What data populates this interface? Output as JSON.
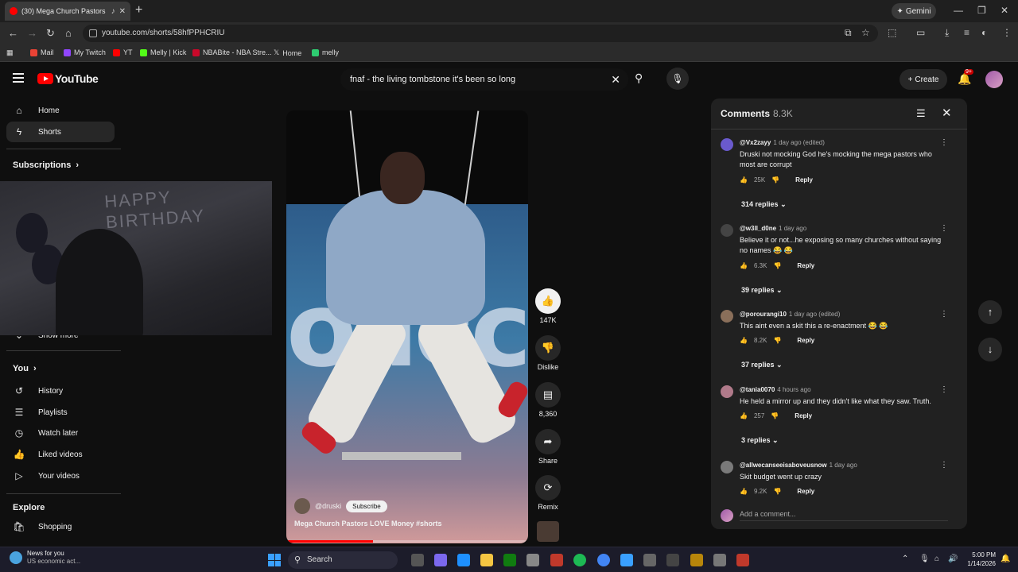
{
  "browser": {
    "tab_title": "(30) Mega Church Pastors L",
    "url": "youtube.com/shorts/58hfPPHCRIU",
    "gemini_label": "Gemini",
    "bookmarks": [
      "Mail",
      "My Twitch",
      "YT",
      "Melly | Kick",
      "NBABite - NBA Stre...",
      "Home",
      "melly"
    ]
  },
  "youtube": {
    "logo_text": "YouTube",
    "search_value": "fnaf - the living tombstone it's been so long",
    "create_label": "Create",
    "notif_badge": "9+"
  },
  "sidebar": {
    "home": "Home",
    "shorts": "Shorts",
    "subscriptions": "Subscriptions",
    "show_more": "Show more",
    "you": "You",
    "you_items": [
      "History",
      "Playlists",
      "Watch later",
      "Liked videos",
      "Your videos"
    ],
    "explore": "Explore",
    "explore_items": [
      "Shopping"
    ],
    "webcam_text": "HAPPY BIRTHDAY"
  },
  "short": {
    "channel": "@druski",
    "subscribe": "Subscribe",
    "title": "Mega Church Pastors LOVE Money #shorts",
    "progress": 0.36,
    "stage_text": "olicc"
  },
  "actions": {
    "likes": "147K",
    "dislike": "Dislike",
    "comments": "8,360",
    "share": "Share",
    "remix": "Remix"
  },
  "comments_panel": {
    "title": "Comments",
    "count": "8.3K",
    "add_placeholder": "Add a comment...",
    "items": [
      {
        "user": "@Vx2zayy",
        "time": "1 day ago (edited)",
        "text": "Druski not mocking God he's mocking the mega pastors who most are corrupt",
        "likes": "25K",
        "reply": "Reply",
        "replies": "314 replies",
        "avatar_color": "#6a5acd"
      },
      {
        "user": "@w3ll_d0ne",
        "time": "1 day ago",
        "text": "Believe it or not...he exposing so many churches without saying no names 😂 😂",
        "likes": "6.3K",
        "reply": "Reply",
        "replies": "39 replies",
        "avatar_color": "#444444"
      },
      {
        "user": "@porourangi10",
        "time": "1 day ago (edited)",
        "text": "This aint even a skit this a re-enactment 😂 😂",
        "likes": "8.2K",
        "reply": "Reply",
        "replies": "37 replies",
        "avatar_color": "#8a6f5a"
      },
      {
        "user": "@tania0070",
        "time": "4 hours ago",
        "text": "He held a mirror up and they didn't like what they saw. Truth.",
        "likes": "257",
        "reply": "Reply",
        "replies": "3 replies",
        "avatar_color": "#b07a8a"
      },
      {
        "user": "@allwecanseeisaboveusnow",
        "time": "1 day ago",
        "text": "Skit budget went up crazy",
        "likes": "9.2K",
        "reply": "Reply",
        "replies": "",
        "avatar_color": "#7a7a7a"
      }
    ]
  },
  "taskbar": {
    "news_title": "News for you",
    "news_sub": "US economic act...",
    "search": "Search",
    "time": "5:00 PM",
    "date": "1/14/2026"
  },
  "colors": {
    "youtube_red": "#ff0000",
    "bg": "#0f0f0f",
    "panel": "#212121",
    "chip": "#272727"
  }
}
